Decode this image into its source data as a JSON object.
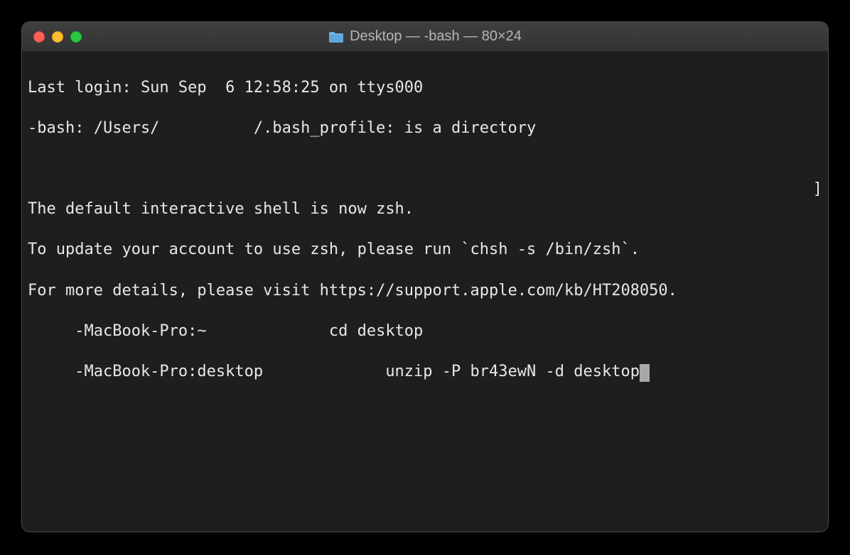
{
  "window": {
    "title": "Desktop — -bash — 80×24"
  },
  "terminal": {
    "lines": {
      "l0": "Last login: Sun Sep  6 12:58:25 on ttys000",
      "l1a": "-bash: /Users/",
      "l1b": "/.bash_profile: is a directory",
      "l2": "",
      "l3": "The default interactive shell is now zsh.",
      "l4": "To update your account to use zsh, please run `chsh -s /bin/zsh`.",
      "l5": "For more details, please visit https://support.apple.com/kb/HT208050.",
      "l6a": "     -MacBook-Pro:~ ",
      "l6b": "            cd desktop",
      "l7a": "     -MacBook-Pro:desktop ",
      "l7b": "            unzip -P br43ewN -d desktop"
    },
    "right_edge_char": "]"
  }
}
